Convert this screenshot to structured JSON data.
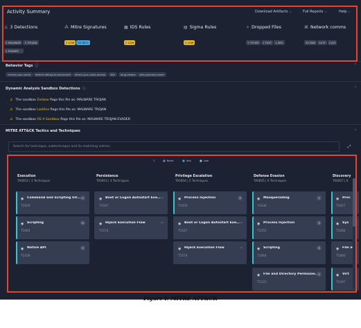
{
  "app": {
    "title": "Activity Summary"
  },
  "topnav": [
    {
      "label": "Download Artifacts",
      "chevron": "chevron-down-icon"
    },
    {
      "label": "Full Reports",
      "chevron": "chevron-down-icon"
    },
    {
      "label": "Help",
      "chevron": "chevron-down-icon"
    }
  ],
  "stats": [
    {
      "icon": "warning-icon",
      "glyph": "⚠",
      "label": "3 Detections",
      "chips": [
        {
          "text": "3 MALWARE",
          "style": "gray"
        },
        {
          "text": "3 TROJAN",
          "style": "gray"
        },
        {
          "text": "1 EVADER",
          "style": "gray"
        }
      ]
    },
    {
      "icon": "crowd-icon",
      "glyph": "⁂",
      "label": "Mitre Signatures",
      "chips": [
        {
          "text": "3 LOW",
          "style": "amber"
        },
        {
          "text": "45 INFO",
          "style": "blue"
        }
      ]
    },
    {
      "icon": "grid-icon",
      "glyph": "▦",
      "label": "IDS Rules",
      "chips": [
        {
          "text": "2 LOW",
          "style": "amber"
        }
      ]
    },
    {
      "icon": "sigma-icon",
      "glyph": "▤",
      "label": "Sigma Rules",
      "chips": [
        {
          "text": "2 LOW",
          "style": "amber"
        }
      ]
    },
    {
      "icon": "files-icon",
      "glyph": "✧",
      "label": "Dropped Files",
      "chips": [
        {
          "text": "7 OTHER",
          "style": "gray"
        },
        {
          "text": "1 TEXT",
          "style": "gray"
        },
        {
          "text": "1 XML",
          "style": "gray"
        }
      ]
    },
    {
      "icon": "network-icon",
      "glyph": "⌘",
      "label": "Network comms",
      "chips": [
        {
          "text": "35 DNS",
          "style": "gray"
        },
        {
          "text": "24 IP",
          "style": "gray"
        },
        {
          "text": "2 JA3",
          "style": "gray"
        }
      ]
    }
  ],
  "behavior": {
    "title": "Behavior Tags",
    "info_icon": "info-icon",
    "tags": [
      "checks-cpu-name",
      "detect-debug-environment",
      "direct-cpu-clock-access",
      "idle",
      "long-sleeps",
      "sets-process-name"
    ]
  },
  "detections": {
    "title": "Dynamic Analysis Sandbox Detections",
    "info_icon": "info-icon",
    "items": [
      {
        "pre": "The sandbox ",
        "sandbox": "Zenbox",
        "post": " flags this file as: MALWARE TROJAN"
      },
      {
        "pre": "The sandbox ",
        "sandbox": "Lastline",
        "post": " flags this file as: MALWARE TROJAN"
      },
      {
        "pre": "The sandbox ",
        "sandbox": "OS X Sandbox",
        "post": " flags this file as: MALWARE TROJAN EVADER"
      }
    ]
  },
  "mitre": {
    "title": "MITRE ATT&CK Tactics and Techniques",
    "search_placeholder": "Search for technique, subtechnique and its matching entries.",
    "legend": [
      {
        "glyph": "▽",
        "label": ""
      },
      {
        "glyph": "■",
        "label": "None"
      },
      {
        "glyph": "■",
        "label": "Info"
      },
      {
        "glyph": "■",
        "label": "Low"
      }
    ],
    "tactics": [
      {
        "name": "Execution",
        "sub": "TA0002  |  3 Techniques"
      },
      {
        "name": "Persistence",
        "sub": "TA0003  |  4 Techniques"
      },
      {
        "name": "Privilege Escalation",
        "sub": "TA0004  |  5 Techniques"
      },
      {
        "name": "Defense Evasion",
        "sub": "TA0005  |  9 Techniques"
      },
      {
        "name": "Discovery",
        "sub": "TA0007  |  6"
      }
    ],
    "cards": [
      {
        "col": 0,
        "row": 0,
        "name": "Command and Scripting Int...",
        "id": "T1059",
        "count": "2",
        "bar": true
      },
      {
        "col": 0,
        "row": 1,
        "name": "Scripting",
        "id": "T1064",
        "count": "5",
        "bar": true
      },
      {
        "col": 0,
        "row": 2,
        "name": "Native API",
        "id": "T1106",
        "count": "1",
        "bar": true
      },
      {
        "col": 1,
        "row": 0,
        "name": "Boot or Logon Autostart Execu...",
        "id": "T1547",
        "chevron": true,
        "bar": false
      },
      {
        "col": 1,
        "row": 1,
        "name": "Hijack Execution Flow",
        "id": "T1574",
        "chevron": true,
        "bar": false
      },
      {
        "col": 2,
        "row": 0,
        "name": "Process Injection",
        "id": "T1055",
        "count": "3",
        "bar": true
      },
      {
        "col": 2,
        "row": 1,
        "name": "Boot or Logon Autostart Execu...",
        "id": "T1547",
        "chevron": true,
        "bar": false
      },
      {
        "col": 2,
        "row": 2,
        "name": "Hijack Execution Flow",
        "id": "T1574",
        "chevron": true,
        "bar": false
      },
      {
        "col": 3,
        "row": 0,
        "name": "Masquerading",
        "id": "T1036",
        "count": "1",
        "bar": true
      },
      {
        "col": 3,
        "row": 1,
        "name": "Process Injection",
        "id": "T1055",
        "count": "3",
        "bar": true
      },
      {
        "col": 3,
        "row": 2,
        "name": "Scripting",
        "id": "T1064",
        "count": "5",
        "bar": true
      },
      {
        "col": 3,
        "row": 3,
        "name": "File and Directory Permission...",
        "id": "T1222",
        "count": "1",
        "bar": false
      },
      {
        "col": 4,
        "row": 0,
        "name": "Proc",
        "id": "T1057",
        "bar": true
      },
      {
        "col": 4,
        "row": 1,
        "name": "Sys",
        "id": "T1082",
        "bar": true
      },
      {
        "col": 4,
        "row": 2,
        "name": "File an",
        "id": "T1083",
        "bar": false
      },
      {
        "col": 4,
        "row": 3,
        "name": "Virt",
        "id": "T1497",
        "bar": true
      }
    ]
  },
  "caption": "Figure I: MITRE ATT&CK",
  "colors": {
    "accent": "#38c6cf",
    "highlight": "#e8c23e",
    "annotation": "#e8452c",
    "background": "#1c2232"
  }
}
